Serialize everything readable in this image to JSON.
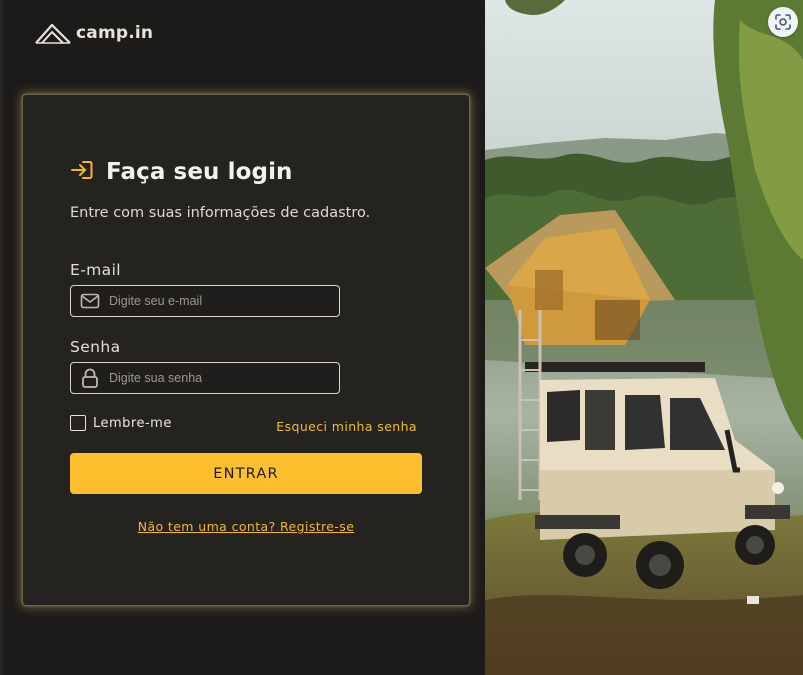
{
  "brand": {
    "name": "camp.in",
    "logo_icon": "tent-logo-icon"
  },
  "login": {
    "title": "Faça seu login",
    "title_icon": "login-arrow-icon",
    "subtitle": "Entre com suas informações de cadastro.",
    "email": {
      "label": "E-mail",
      "placeholder": "Digite seu e-mail",
      "value": "",
      "icon": "mail-icon"
    },
    "password": {
      "label": "Senha",
      "placeholder": "Digite sua senha",
      "value": "",
      "icon": "lock-icon"
    },
    "remember_label": "Lembre-me",
    "remember_checked": false,
    "forgot_link": "Esqueci minha senha",
    "submit_label": "ENTRAR",
    "signup_link": "Não tem uma conta? Registre-se"
  },
  "photo": {
    "lens_icon": "visual-search-icon"
  },
  "colors": {
    "accent": "#fbbf2f",
    "background": "#1d1b19",
    "card": "#252320",
    "text": "#f3f1ec"
  }
}
